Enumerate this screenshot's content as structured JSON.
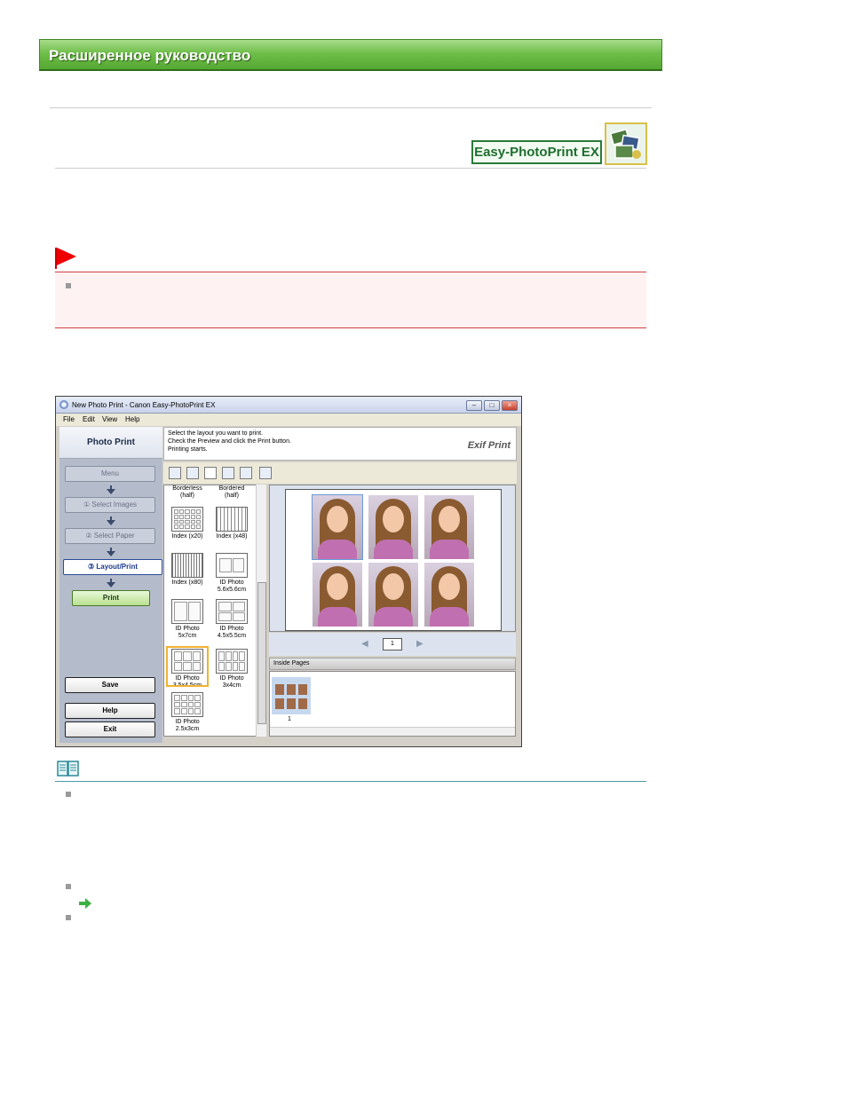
{
  "header": {
    "title": "Расширенное руководство"
  },
  "logo": {
    "text": "Easy-PhotoPrint EX",
    "icon": "photos-icon"
  },
  "app": {
    "window_title": "New Photo Print - Canon Easy-PhotoPrint EX",
    "menu": [
      "File",
      "Edit",
      "View",
      "Help"
    ],
    "panel_title": "Photo Print",
    "steps": {
      "menu": "Menu",
      "select_images": "① Select Images",
      "select_paper": "② Select Paper",
      "layout_print": "③ Layout/Print"
    },
    "buttons": {
      "print": "Print",
      "save": "Save",
      "help": "Help",
      "exit": "Exit"
    },
    "instructions": [
      "Select the layout you want to print.",
      "Check the Preview and click the Print button.",
      "Printing starts."
    ],
    "exif_logo": "Exif Print",
    "layouts": [
      {
        "label1": "Borderless",
        "label2": "(half)"
      },
      {
        "label1": "Bordered",
        "label2": "(half)"
      },
      {
        "label1": "Index (x20)",
        "label2": ""
      },
      {
        "label1": "Index (x48)",
        "label2": ""
      },
      {
        "label1": "Index (x80)",
        "label2": ""
      },
      {
        "label1": "ID Photo",
        "label2": "5.6x5.6cm"
      },
      {
        "label1": "ID Photo",
        "label2": "5x7cm"
      },
      {
        "label1": "ID Photo",
        "label2": "4.5x5.5cm"
      },
      {
        "label1": "ID Photo",
        "label2": "3.5x4.5cm"
      },
      {
        "label1": "ID Photo",
        "label2": "3x4cm"
      },
      {
        "label1": "ID Photo",
        "label2": "2.5x3cm"
      }
    ],
    "selected_layout_index": 8,
    "page_number": "1",
    "inside_pages_label": "Inside Pages",
    "thumbnail_label": "1"
  },
  "colors": {
    "banner_green": "#6fbe4a",
    "important_red": "#d04040",
    "note_teal": "#4a9aa8",
    "selection_orange": "#f2b230"
  }
}
